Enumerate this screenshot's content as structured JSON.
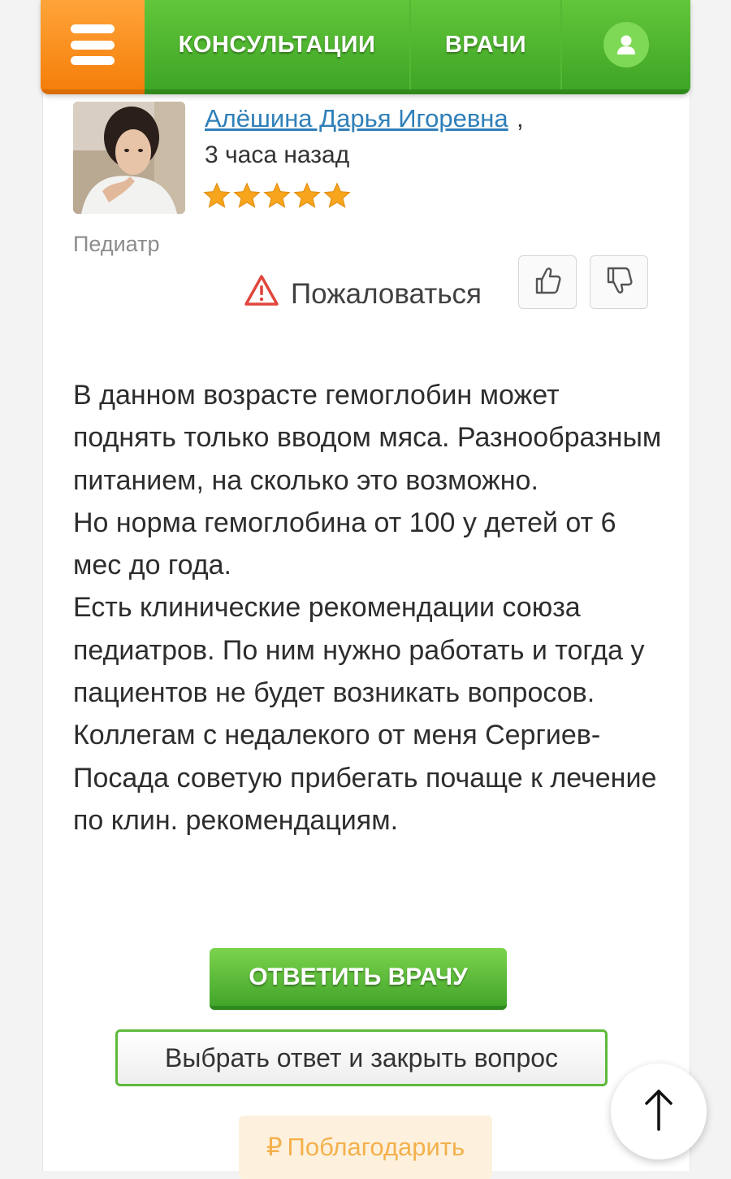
{
  "nav": {
    "menu_icon": "hamburger-icon",
    "consultations_label": "КОНСУЛЬТАЦИИ",
    "doctors_label": "ВРАЧИ",
    "profile_icon": "user-icon",
    "accent_orange": "#f57f0a",
    "accent_green": "#4cb22f"
  },
  "answer": {
    "author_name": "Алёшина Дарья Игоревна",
    "author_suffix": ",",
    "time_ago": "3 часа назад",
    "rating": 5,
    "rating_max": 5,
    "specialty": "Педиатр",
    "complain_label": "Пожаловаться",
    "complain_icon": "warning-icon",
    "like_icon": "thumbs-up-icon",
    "dislike_icon": "thumbs-down-icon",
    "paragraphs": [
      "В данном возрасте гемоглобин может поднять только вводом мяса. Разнообразным питанием, на сколько это возможно.",
      "Но норма гемоглобина от 100 у детей от 6 мес до года.",
      "Есть клинические рекомендации союза педиатров. По ним нужно работать и тогда у пациентов не будет возникать вопросов. Коллегам с недалекого от меня Сергиев-Посада советую прибегать почаще к лечение по клин. рекомендациям."
    ]
  },
  "actions": {
    "reply_label": "ОТВЕТИТЬ ВРАЧУ",
    "choose_label": "Выбрать ответ и закрыть вопрос",
    "thank_symbol": "₽",
    "thank_label": "Поблагодарить",
    "scroll_top_icon": "arrow-up-icon"
  }
}
